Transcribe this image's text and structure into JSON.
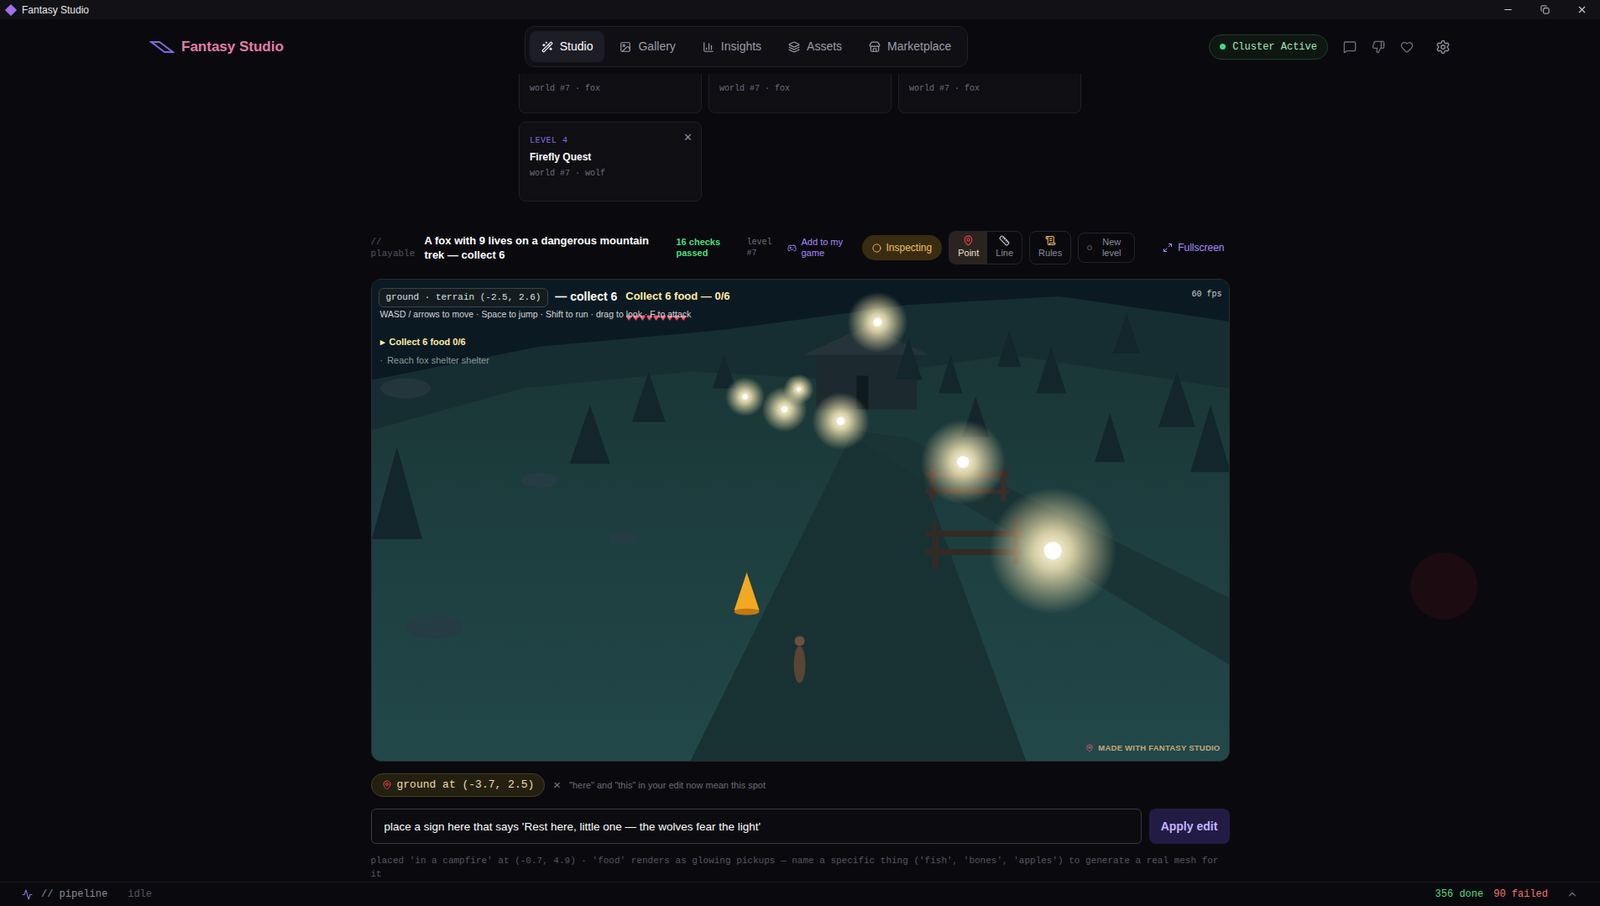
{
  "window": {
    "title": "Fantasy Studio"
  },
  "header": {
    "logo": "Fantasy Studio",
    "nav": [
      {
        "label": "Studio",
        "selected": true
      },
      {
        "label": "Gallery",
        "selected": false
      },
      {
        "label": "Insights",
        "selected": false
      },
      {
        "label": "Assets",
        "selected": false
      },
      {
        "label": "Marketplace",
        "selected": false
      }
    ],
    "status": "Cluster Active"
  },
  "levels_cut": [
    {
      "meta": "world #7 · fox"
    },
    {
      "meta": "world #7 · fox"
    },
    {
      "meta": "world #7 · fox"
    }
  ],
  "level_card": {
    "label": "LEVEL 4",
    "title": "Firefly Quest",
    "meta": "world #7 · wolf",
    "close": "✕"
  },
  "playable": {
    "prefix": "//",
    "tag": "playable",
    "title": "A fox with 9 lives on a dangerous mountain trek — collect 6",
    "checks": "16 checks passed",
    "level_label": "level",
    "level": "#7",
    "add": "Add to my game",
    "inspecting": "Inspecting",
    "tools": [
      {
        "label": "Point",
        "selected": true
      },
      {
        "label": "Line",
        "selected": false
      },
      {
        "label": "Rules",
        "selected": false
      }
    ],
    "new_level": "New level",
    "fullscreen": "Fullscreen"
  },
  "game": {
    "hover_chip": "ground · terrain (-2.5, 2.6)",
    "title_tail": "— collect 6",
    "objective": "Collect 6 food — 0/6",
    "hearts": "♥♥♥♥♥♥♥♥♥",
    "fps": "60 fps",
    "controls": "WASD / arrows to move · Space to jump · Shift to run · drag to look · F to attack",
    "quests": [
      {
        "marker": "▸",
        "text": "Collect 6 food 0/6",
        "active": true
      },
      {
        "marker": "·",
        "text": "Reach fox shelter shelter",
        "active": false
      }
    ],
    "watermark": "MADE WITH FANTASY STUDIO"
  },
  "edit": {
    "target": "ground at (-3.7, 2.5)",
    "clear": "×",
    "hint": "\"here\" and \"this\" in your edit now mean this spot",
    "input": "place a sign here that says 'Rest here, little one — the wolves fear the light'",
    "button": "Apply edit",
    "log": "placed 'in a campfire' at (-0.7, 4.9) · 'food' renders as glowing pickups — name a specific thing ('fish', 'bones', 'apples') to generate a real mesh for it"
  },
  "status_bar": {
    "prefix": "//",
    "label": "pipeline",
    "state": "idle",
    "done": "356 done",
    "failed": "90 failed"
  }
}
